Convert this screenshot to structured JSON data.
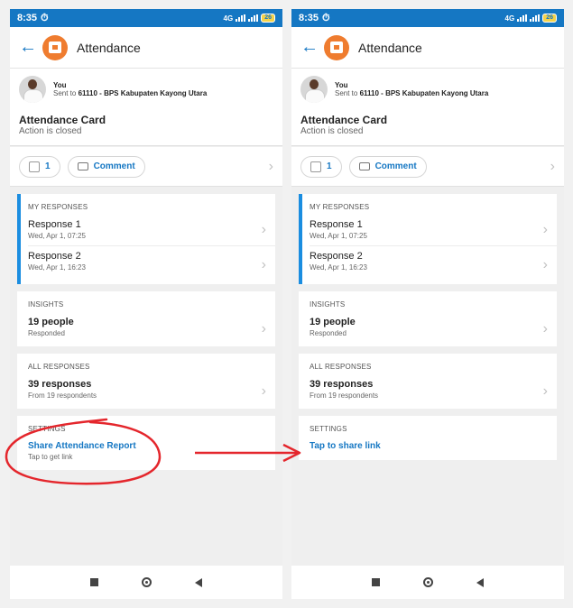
{
  "status": {
    "time": "8:35",
    "battery": "26",
    "net": "4G"
  },
  "app": {
    "title": "Attendance"
  },
  "sender": {
    "name": "You",
    "sent_prefix": "Sent to",
    "group": "61110 - BPS Kabupaten Kayong Utara"
  },
  "card": {
    "title": "Attendance Card",
    "subtitle": "Action is closed"
  },
  "actions": {
    "like_count": "1",
    "comment_label": "Comment"
  },
  "my_responses": {
    "label": "MY RESPONSES",
    "items": [
      {
        "title": "Response 1",
        "time": "Wed, Apr 1, 07:25"
      },
      {
        "title": "Response 2",
        "time": "Wed, Apr 1, 16:23"
      }
    ]
  },
  "insights": {
    "label": "INSIGHTS",
    "value": "19 people",
    "sub": "Responded"
  },
  "all_responses": {
    "label": "ALL RESPONSES",
    "value": "39 responses",
    "sub": "From 19 respondents"
  },
  "settings_left": {
    "label": "SETTINGS",
    "link": "Share Attendance Report",
    "sub": "Tap to get link"
  },
  "settings_right": {
    "label": "SETTINGS",
    "link": "Tap to share link"
  },
  "colors": {
    "primary": "#1577c3",
    "accent": "#ef7c2f",
    "annotation": "#e4262c"
  }
}
